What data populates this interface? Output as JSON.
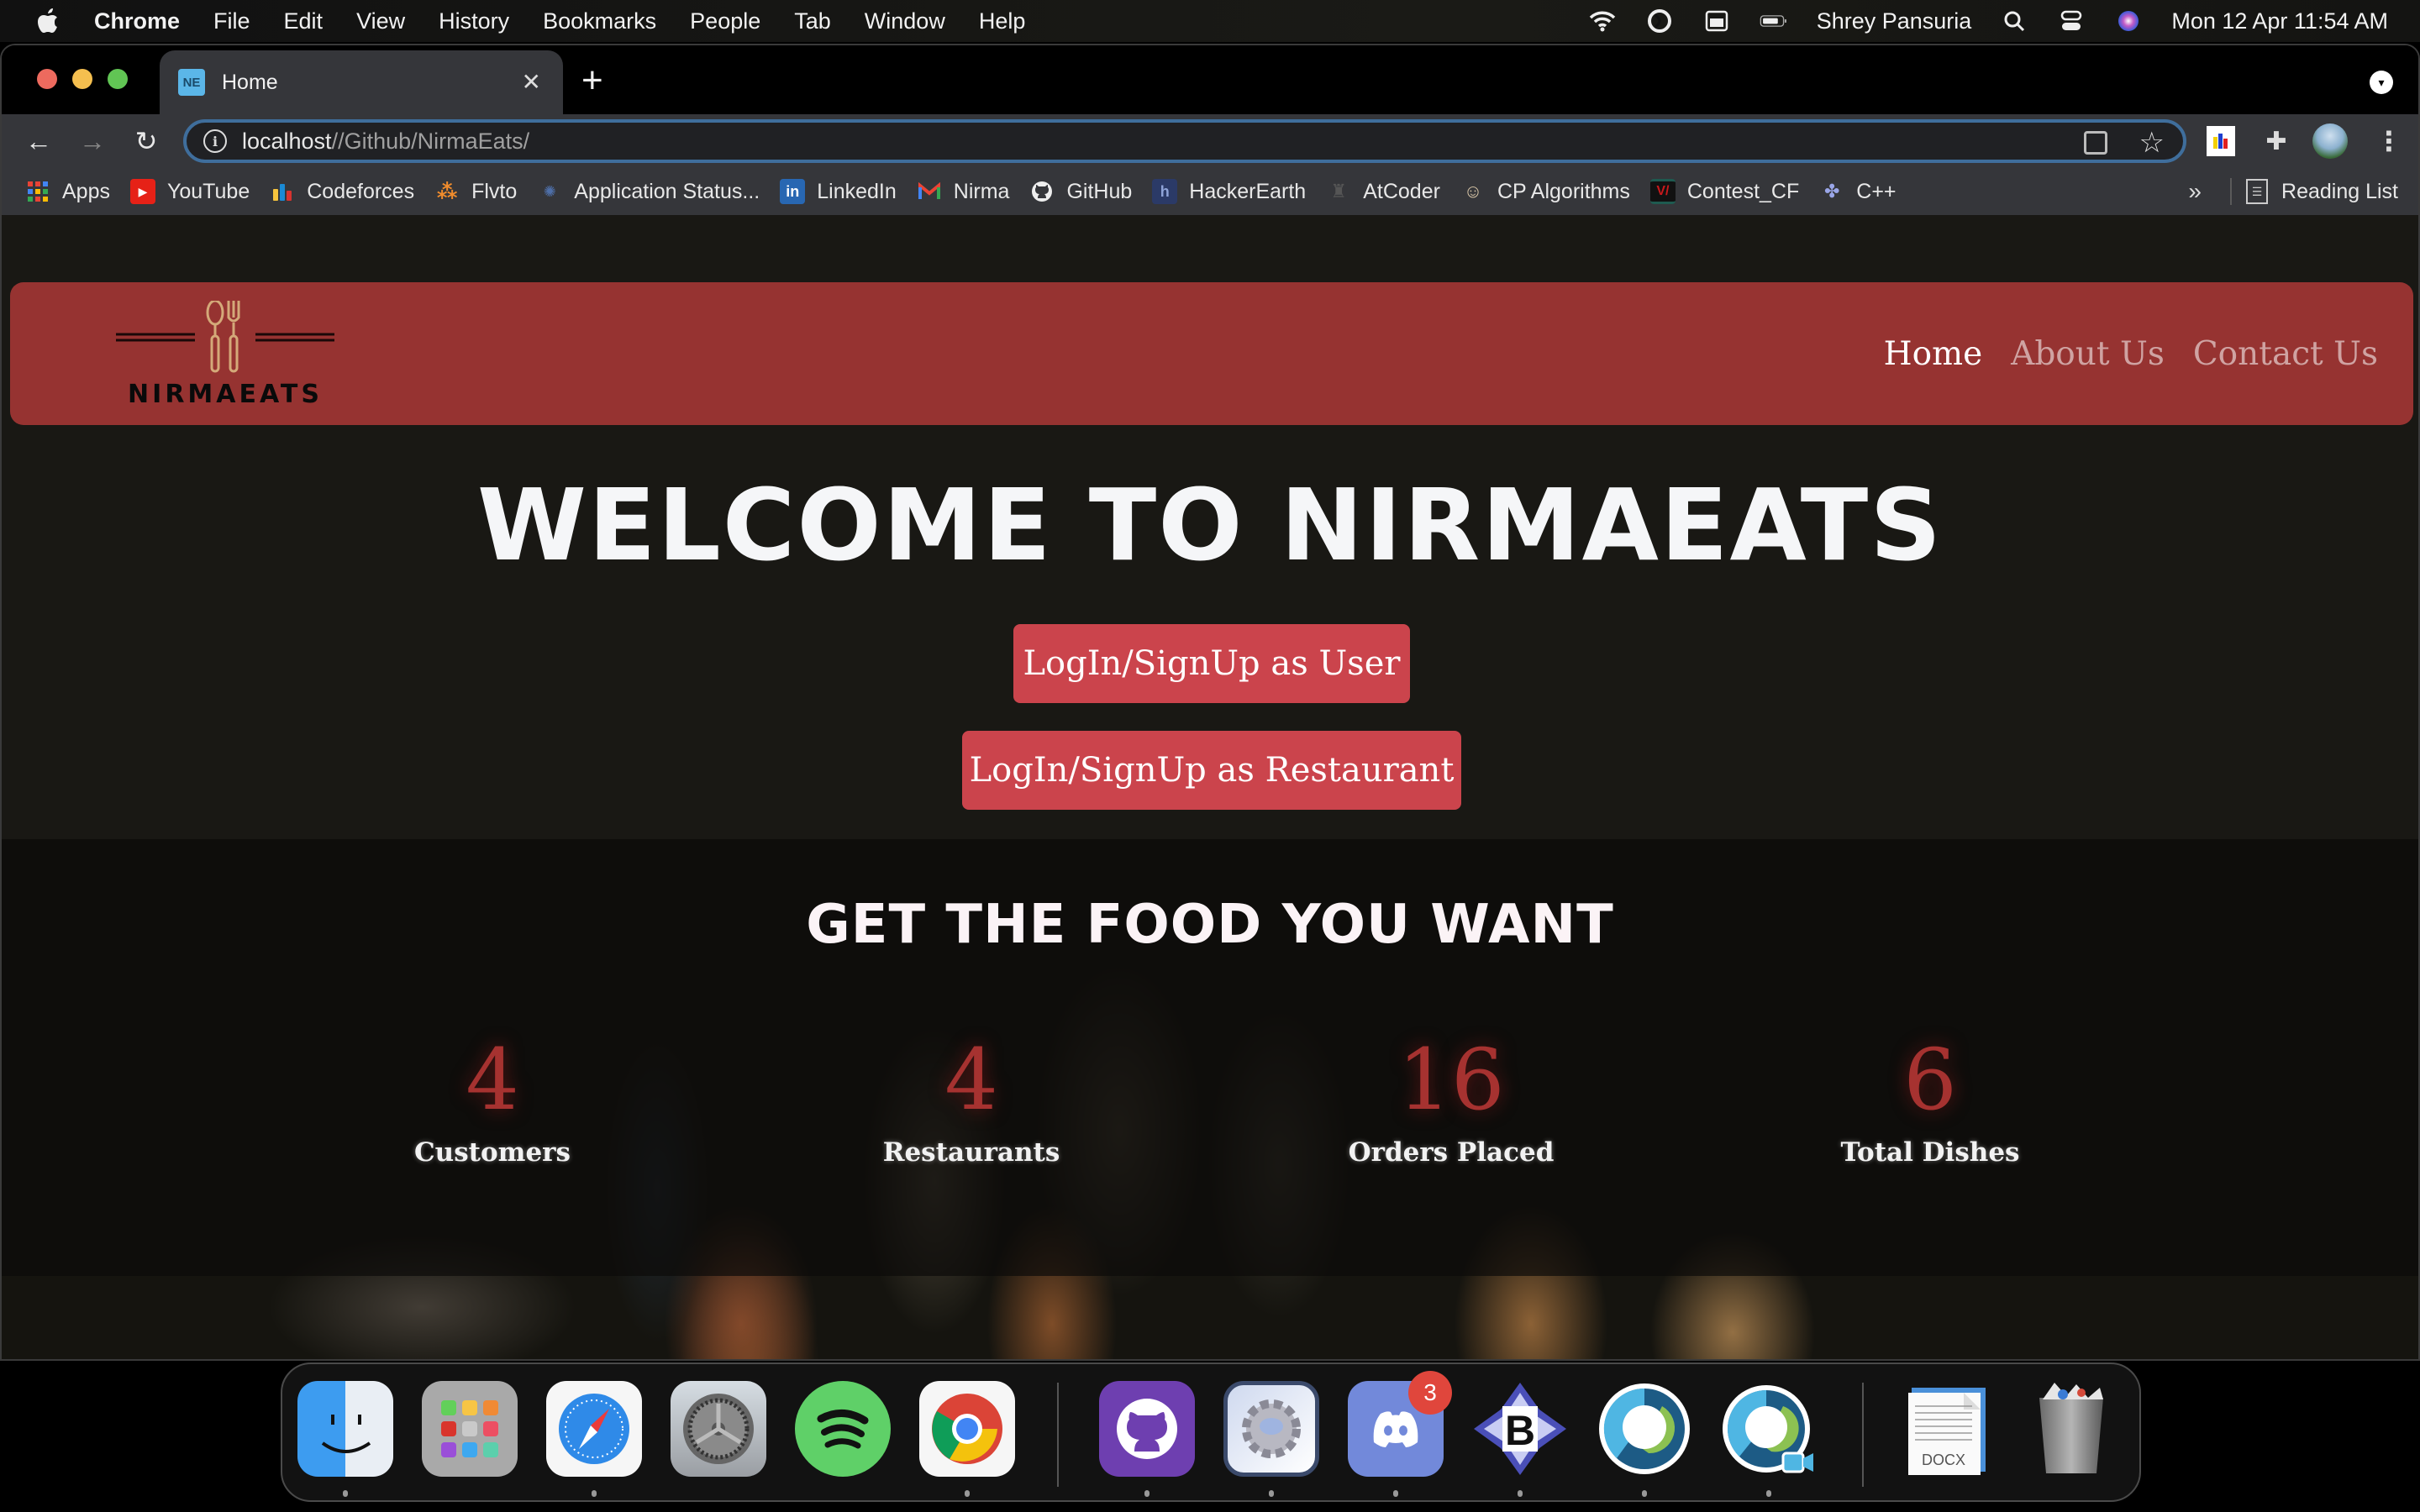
{
  "menubar": {
    "app_name": "Chrome",
    "items": [
      "File",
      "Edit",
      "View",
      "History",
      "Bookmarks",
      "People",
      "Tab",
      "Window",
      "Help"
    ],
    "user": "Shrey Pansuria",
    "datetime": "Mon 12 Apr  11:54 AM",
    "status_icons": [
      "wifi-icon",
      "sync-icon",
      "keyboard-icon",
      "battery-icon",
      "spotlight-search-icon",
      "control-center-icon",
      "siri-icon"
    ]
  },
  "browser": {
    "tab": {
      "title": "Home",
      "favicon_text": "NE"
    },
    "url_host": "localhost",
    "url_path": "//Github/NirmaEats/",
    "bookmarks": [
      {
        "label": "Apps",
        "icon": "apps-grid-icon"
      },
      {
        "label": "YouTube",
        "icon": "youtube-icon"
      },
      {
        "label": "Codeforces",
        "icon": "codeforces-icon"
      },
      {
        "label": "Flvto",
        "icon": "flvto-icon"
      },
      {
        "label": "Application Status...",
        "icon": "application-status-icon"
      },
      {
        "label": "LinkedIn",
        "icon": "linkedin-icon"
      },
      {
        "label": "Nirma",
        "icon": "gmail-icon"
      },
      {
        "label": "GitHub",
        "icon": "github-icon"
      },
      {
        "label": "HackerEarth",
        "icon": "hackerearth-icon"
      },
      {
        "label": "AtCoder",
        "icon": "atcoder-icon"
      },
      {
        "label": "CP Algorithms",
        "icon": "cp-algorithms-icon"
      },
      {
        "label": "Contest_CF",
        "icon": "contest-cf-icon"
      },
      {
        "label": "C++",
        "icon": "cpp-icon"
      }
    ],
    "more_bookmarks": "»",
    "reading_list": "Reading List"
  },
  "site": {
    "brand": "NIRMAEATS",
    "nav": [
      {
        "label": "Home",
        "active": true
      },
      {
        "label": "About Us",
        "active": false
      },
      {
        "label": "Contact Us",
        "active": false
      }
    ],
    "hero_title": "WELCOME TO NIRMAEATS",
    "buttons": {
      "user": "LogIn/SignUp as User",
      "restaurant": "LogIn/SignUp as Restaurant"
    },
    "section_title": "GET THE FOOD YOU WANT",
    "stats": [
      {
        "value": "4",
        "label": "Customers"
      },
      {
        "value": "4",
        "label": "Restaurants"
      },
      {
        "value": "16",
        "label": "Orders Placed"
      },
      {
        "value": "6",
        "label": "Total Dishes"
      }
    ],
    "colors": {
      "navbar": "#963331",
      "button": "#cb444c",
      "stat_number": "#a63230"
    }
  },
  "dock": {
    "apps": [
      "Finder",
      "Launchpad",
      "Safari",
      "System Preferences",
      "Spotify",
      "Google Chrome",
      "GitHub Desktop",
      "Preferences",
      "Discord",
      "BBEdit",
      "Webex",
      "Webex Meetings"
    ],
    "discord_badge": "3",
    "docs": [
      "DOCX document",
      "Trash"
    ]
  }
}
